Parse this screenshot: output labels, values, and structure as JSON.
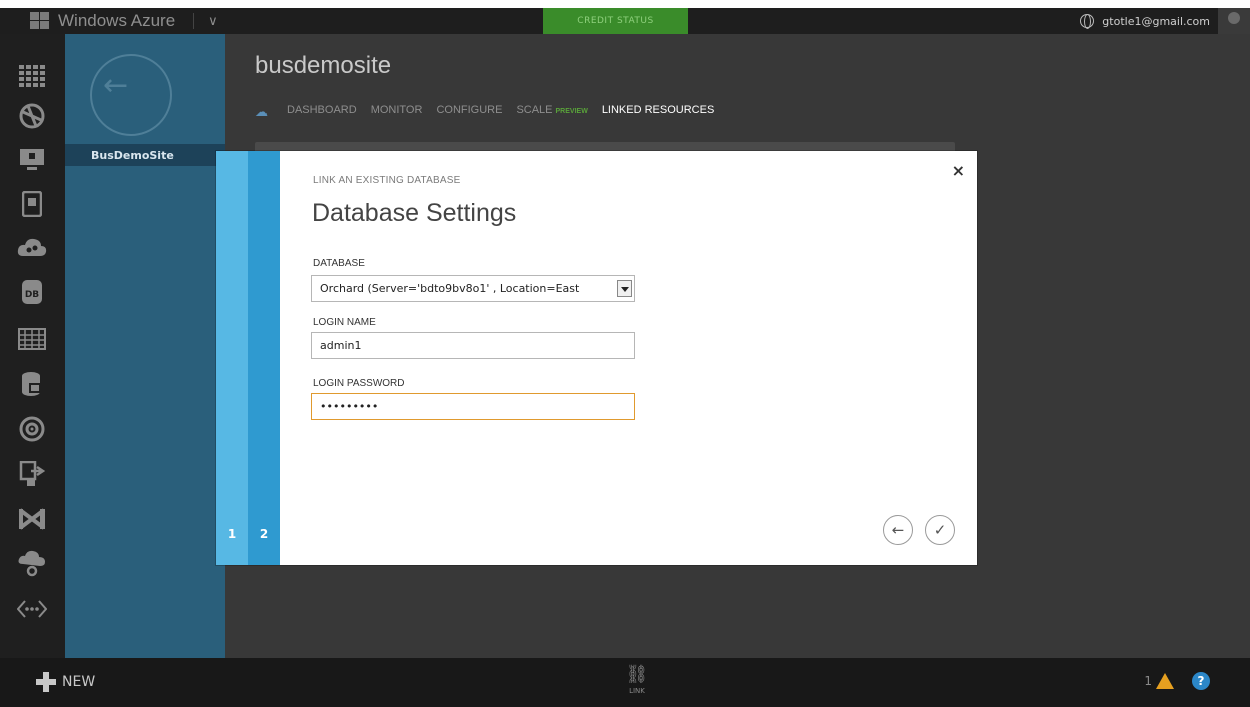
{
  "topbar": {
    "brand": "Windows Azure",
    "credit_status": "CREDIT STATUS",
    "user_email": "gtotle1@gmail.com"
  },
  "sidebar": {
    "site_item": "BusDemoSite",
    "icons": [
      "all-items-icon",
      "web-sites-icon",
      "virtual-machines-icon",
      "mobile-services-icon",
      "cloud-services-icon",
      "sql-databases-icon",
      "storage-icon",
      "hdinsight-icon",
      "media-services-icon",
      "service-bus-icon",
      "visual-studio-icon",
      "networks-icon",
      "traffic-manager-icon"
    ]
  },
  "main": {
    "site_title": "busdemosite",
    "tabs": [
      {
        "label": "DASHBOARD"
      },
      {
        "label": "MONITOR"
      },
      {
        "label": "CONFIGURE"
      },
      {
        "label": "SCALE"
      },
      {
        "label": "LINKED RESOURCES"
      }
    ],
    "preview_badge": "PREVIEW"
  },
  "modal": {
    "subtitle": "LINK AN EXISTING DATABASE",
    "title": "Database Settings",
    "database_label": "DATABASE",
    "database_value": "Orchard (Server='bdto9bv8o1' , Location=East",
    "login_name_label": "LOGIN NAME",
    "login_name_value": "admin1",
    "login_password_label": "LOGIN PASSWORD",
    "login_password_value": "•••••••••",
    "steps": [
      "1",
      "2"
    ],
    "close": "×"
  },
  "bottombar": {
    "new_label": "NEW",
    "link_label": "LINK",
    "warning_count": "1",
    "help": "?"
  },
  "colors": {
    "credit": "#3a8c2a",
    "step1": "#57b8e4",
    "step2": "#2f9ad0",
    "focus": "#e09a2e",
    "sidebar": "#2a5f7b"
  }
}
